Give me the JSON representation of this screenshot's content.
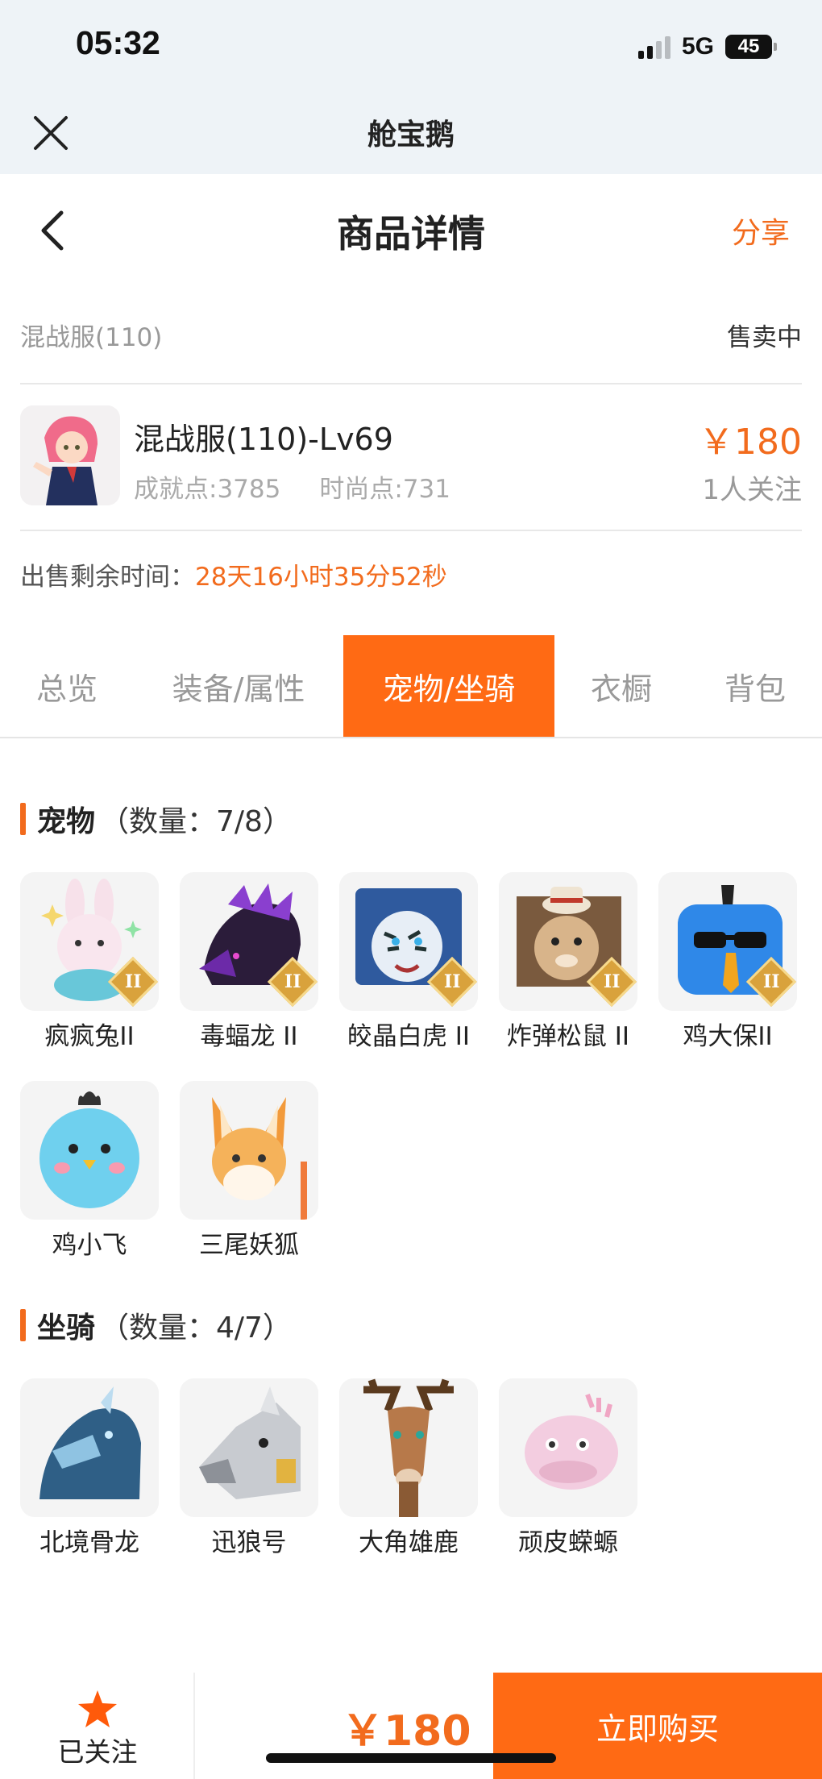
{
  "status_bar": {
    "time": "05:32",
    "network": "5G",
    "battery": "45"
  },
  "webview": {
    "title": "舱宝鹅"
  },
  "nav": {
    "title": "商品详情",
    "share": "分享"
  },
  "listing": {
    "server": "混战服(110)",
    "status": "售卖中",
    "product_name": "混战服(110)-Lv69",
    "achievement": "成就点:3785",
    "fashion": "时尚点:731",
    "price": "￥180",
    "followers": "1人关注",
    "countdown_label": "出售剩余时间：",
    "countdown_value": "28天16小时35分52秒"
  },
  "tabs": [
    {
      "label": "总览",
      "active": false
    },
    {
      "label": "装备/属性",
      "active": false
    },
    {
      "label": "宠物/坐骑",
      "active": true
    },
    {
      "label": "衣橱",
      "active": false
    },
    {
      "label": "背包",
      "active": false
    }
  ],
  "pets": {
    "title": "宠物",
    "count": "（数量：7/8）",
    "items": [
      {
        "name": "疯疯兔II",
        "badge": "II",
        "icon": "rabbit-icon"
      },
      {
        "name": "毒蝠龙 II",
        "badge": "II",
        "icon": "dragon-icon"
      },
      {
        "name": "皎晶白虎 II",
        "badge": "II",
        "icon": "tiger-icon"
      },
      {
        "name": "炸弹松鼠 II",
        "badge": "II",
        "icon": "squirrel-icon"
      },
      {
        "name": "鸡大保II",
        "badge": "II",
        "icon": "chicken-boss-icon"
      },
      {
        "name": "鸡小飞",
        "badge": "",
        "icon": "chick-icon"
      },
      {
        "name": "三尾妖狐",
        "badge": "",
        "icon": "fox-icon"
      }
    ]
  },
  "mounts": {
    "title": "坐骑",
    "count": "（数量：4/7）",
    "items": [
      {
        "name": "北境骨龙",
        "icon": "bone-dragon-icon"
      },
      {
        "name": "迅狼号",
        "icon": "mech-wolf-icon"
      },
      {
        "name": "大角雄鹿",
        "icon": "stag-icon"
      },
      {
        "name": "顽皮蝾螈",
        "icon": "axolotl-icon"
      }
    ]
  },
  "bottom": {
    "follow_label": "已关注",
    "price": "￥180",
    "buy_label": "立即购买"
  },
  "colors": {
    "accent": "#ff6a14",
    "price": "#f26b1d"
  }
}
